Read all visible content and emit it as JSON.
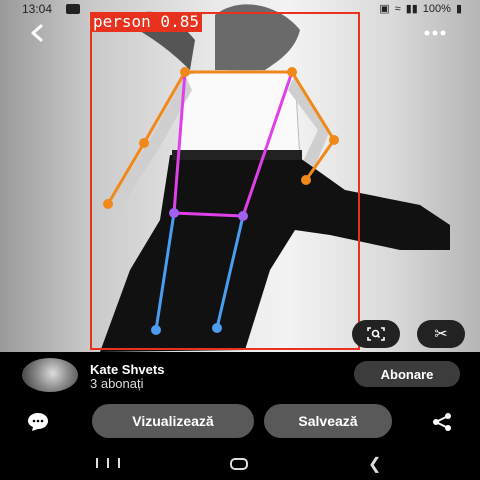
{
  "status_bar": {
    "time": "13:04",
    "battery": "100%",
    "icons": [
      "gallery-icon",
      "lock-icon",
      "wifi-icon",
      "volte-icon",
      "signal-icon",
      "battery-icon"
    ]
  },
  "top_bar": {
    "back_icon": "chevron-left-icon",
    "more_icon": "more-horizontal-icon"
  },
  "detection": {
    "label": "person 0.85",
    "box_color": "#e8321e",
    "skeleton_colors": {
      "arms": "#f0881a",
      "torso": "#e040e8",
      "legs": "#4a9df0"
    }
  },
  "image_tools": {
    "lens_icon": "visual-search-icon",
    "scissors_icon": "scissors-icon"
  },
  "profile": {
    "name": "Kate Shvets",
    "subscribers": "3 abonați",
    "subscribe_label": "Abonare"
  },
  "actions": {
    "comment_icon": "comment-bubble-icon",
    "visit_label": "Vizualizează",
    "save_label": "Salvează",
    "share_icon": "share-icon"
  },
  "nav_bar": {
    "recents_icon": "recents-icon",
    "home_icon": "home-icon",
    "back_icon": "nav-back-icon"
  }
}
